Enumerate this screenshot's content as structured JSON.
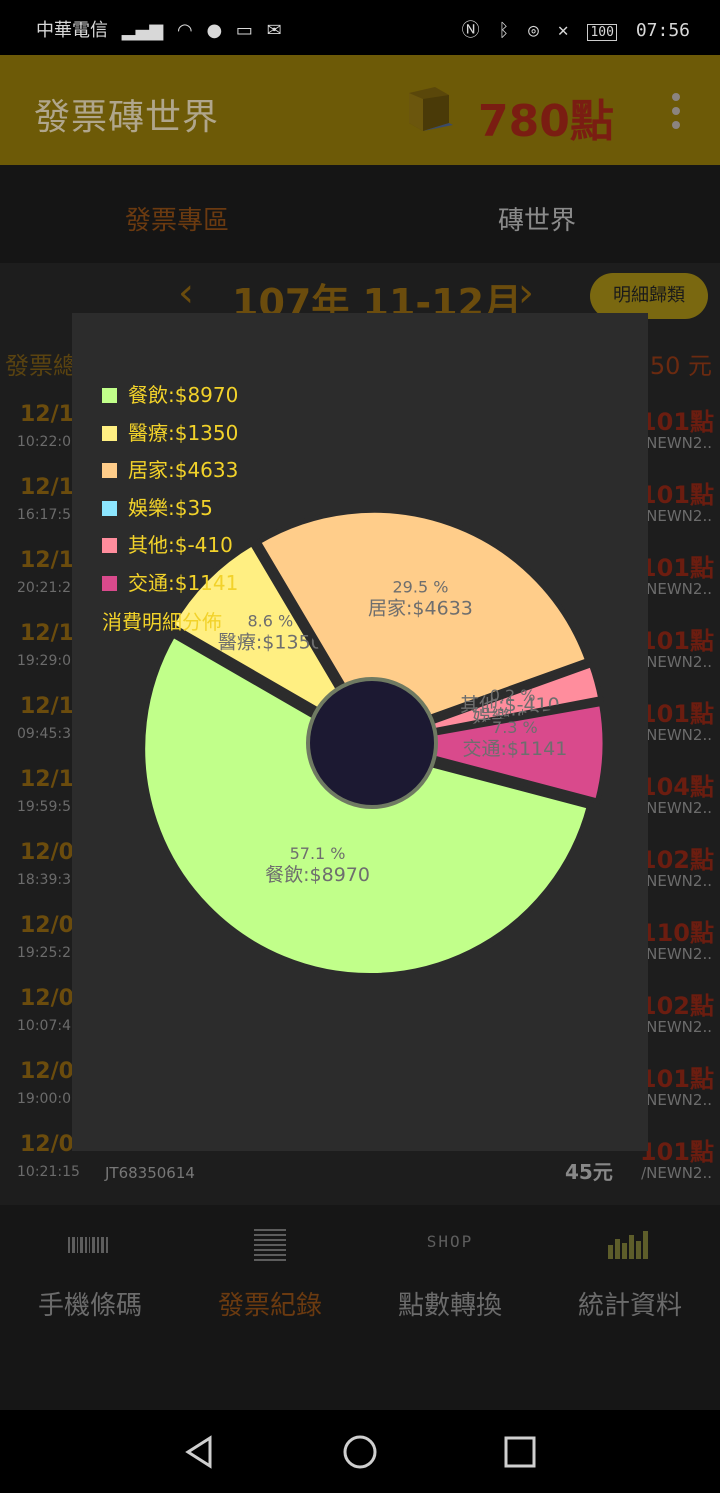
{
  "status": {
    "carrier": "中華電信",
    "battery": "100",
    "time": "07:56"
  },
  "app": {
    "title": "發票磚世界",
    "points": "780點"
  },
  "tabs": [
    "發票專區",
    "磚世界"
  ],
  "period": {
    "prev": "‹",
    "label": "107年 11-12月",
    "next": "›",
    "detail_button": "明細歸類"
  },
  "summary": {
    "left": "發票總",
    "right": "50 元"
  },
  "invoices": [
    {
      "date": "12/1",
      "time": "10:22:0",
      "points": "101點",
      "source": "NEWN2.."
    },
    {
      "date": "12/1",
      "time": "16:17:5",
      "points": "101點",
      "source": "NEWN2.."
    },
    {
      "date": "12/1",
      "time": "20:21:2",
      "points": "101點",
      "source": "NEWN2.."
    },
    {
      "date": "12/1",
      "time": "19:29:0",
      "points": "101點",
      "source": "NEWN2.."
    },
    {
      "date": "12/1",
      "time": "09:45:3",
      "points": "101點",
      "source": "NEWN2.."
    },
    {
      "date": "12/1",
      "time": "19:59:5",
      "points": "104點",
      "source": "NEWN2.."
    },
    {
      "date": "12/0",
      "time": "18:39:3",
      "points": "102點",
      "source": "NEWN2.."
    },
    {
      "date": "12/0",
      "time": "19:25:2",
      "points": "110點",
      "source": "NEWN2.."
    },
    {
      "date": "12/0",
      "time": "10:07:4",
      "points": "102點",
      "source": "NEWN2.."
    },
    {
      "date": "12/0",
      "time": "19:00:0",
      "points": "101點",
      "source": "NEWN2.."
    },
    {
      "date": "12/0",
      "time": "10:21:15",
      "invoice": "JT68350614",
      "amount": "45元",
      "points": "101點",
      "source": "/NEWN2.."
    }
  ],
  "bottom_nav": [
    {
      "label": "手機條碼",
      "icon": "barcode-icon"
    },
    {
      "label": "發票紀錄",
      "icon": "list-icon"
    },
    {
      "label": "點數轉換",
      "icon": "shop-icon",
      "icon_text": "SHOP"
    },
    {
      "label": "統計資料",
      "icon": "bar-chart-icon"
    }
  ],
  "chart_data": {
    "type": "pie",
    "subtitle": "消費明細分佈",
    "legend_position": "top-left",
    "categories": [
      "餐飲",
      "醫療",
      "居家",
      "娛樂",
      "其他",
      "交通"
    ],
    "values": [
      8970,
      1350,
      4633,
      35,
      -410,
      1141
    ],
    "percent_labels": [
      "57.1 %",
      "8.6 %",
      "29.5 %",
      "0.2 %",
      "",
      "7.3 %"
    ],
    "legend_labels": [
      "餐飲:$8970",
      "醫療:$1350",
      "居家:$4633",
      "娛樂:$35",
      "其他:$-410",
      "交通:$1141"
    ],
    "colors": [
      "#c1ff8a",
      "#ffef82",
      "#ffcd8a",
      "#8ce6ff",
      "#ff8d9d",
      "#d94a8c"
    ],
    "hole_color": "#1c1932"
  }
}
